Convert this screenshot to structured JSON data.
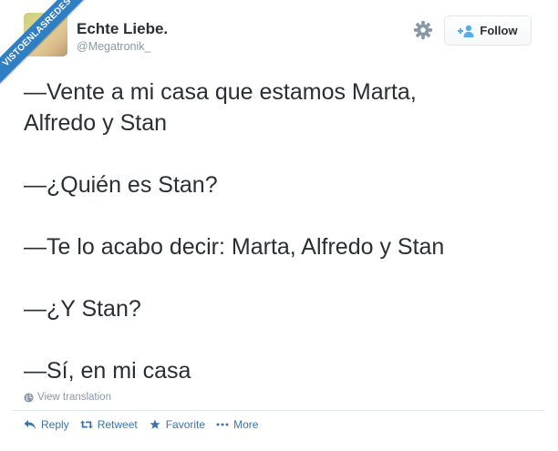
{
  "watermark": {
    "text": "VISTOENLASREDES",
    "color": "#2f7fc4"
  },
  "author": {
    "display_name": "Echte Liebe.",
    "username": "@Megatronik_"
  },
  "header": {
    "settings_icon": "gear-icon",
    "follow_label": "Follow",
    "follow_icon": "person-plus-icon"
  },
  "tweet": {
    "lines": [
      "—Vente a mi casa que estamos Marta,",
      "Alfredo y Stan",
      "—¿Quién es Stan?",
      "—Te lo acabo decir: Marta, Alfredo y Stan",
      "—¿Y Stan?",
      "—Sí, en mi casa"
    ],
    "translation_label": "View translation"
  },
  "actions": [
    {
      "label": "Reply",
      "icon": "reply-icon"
    },
    {
      "label": "Retweet",
      "icon": "retweet-icon"
    },
    {
      "label": "Favorite",
      "icon": "star-icon"
    },
    {
      "label": "More",
      "icon": "more-icon"
    }
  ],
  "colors": {
    "link": "#3b73a8",
    "muted": "#8899a6",
    "text": "#292f33",
    "border": "#e1e8ed"
  }
}
